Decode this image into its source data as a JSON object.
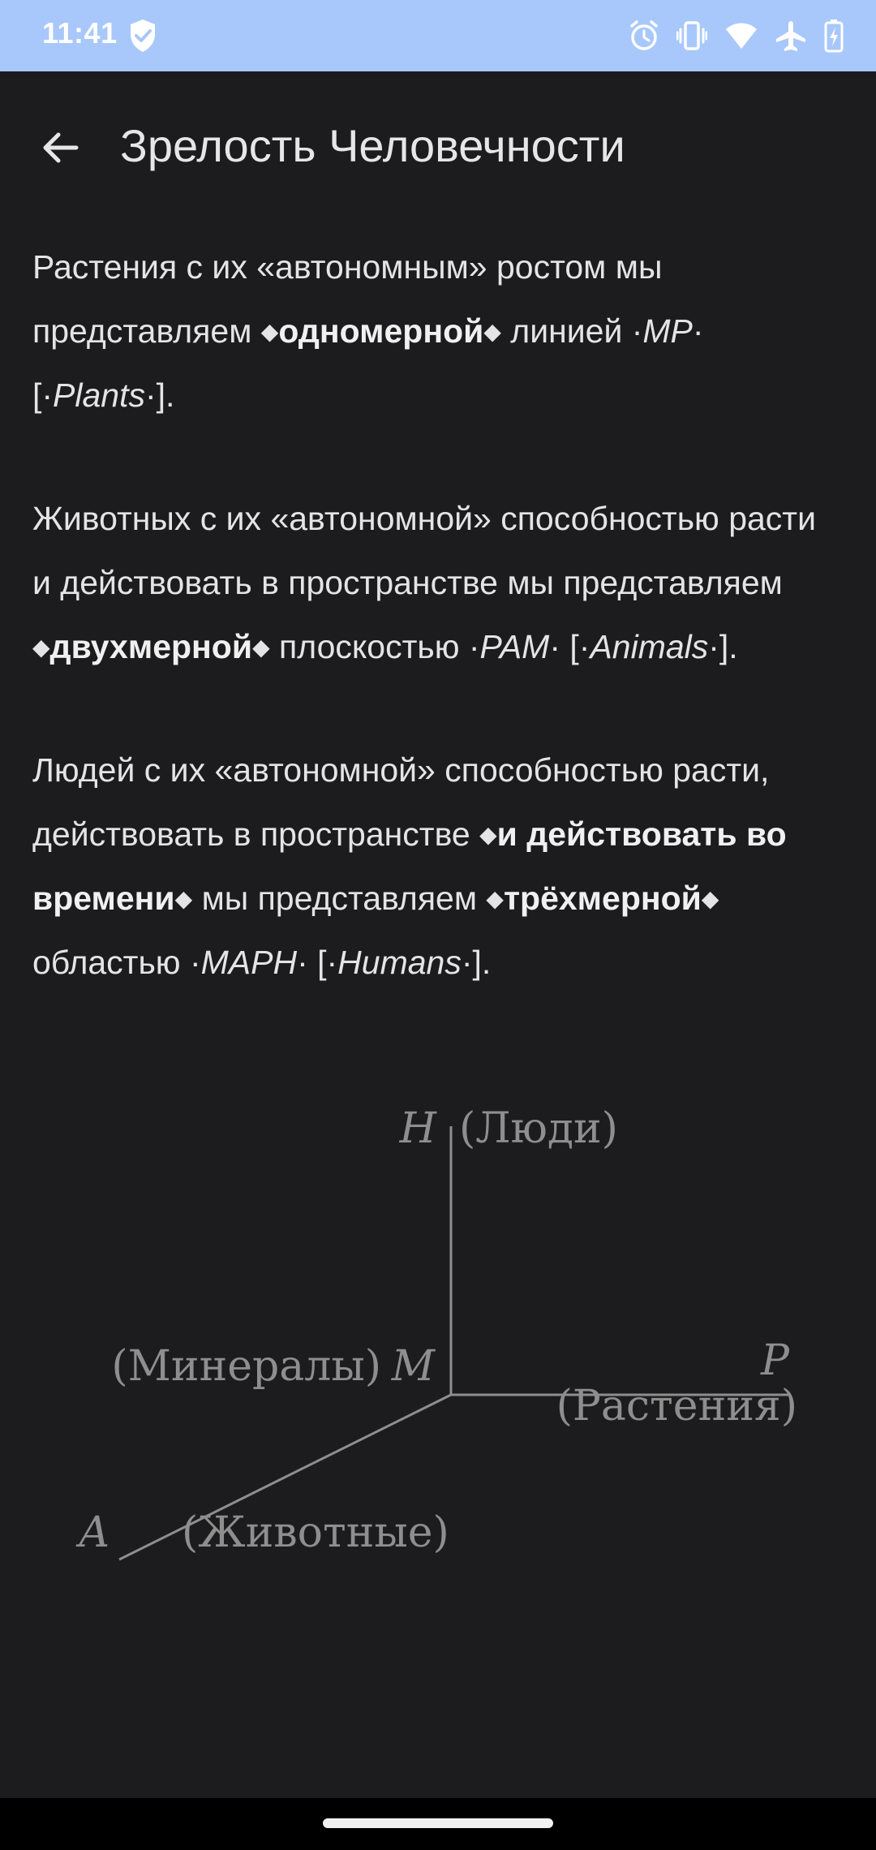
{
  "status_bar": {
    "time": "11:41",
    "icons": [
      "shield-check-icon",
      "alarm-icon",
      "vibrate-icon",
      "wifi-icon",
      "airplane-icon",
      "battery-charging-icon"
    ]
  },
  "header": {
    "title": "Зрелость Человечности",
    "back_icon": "arrow-back-icon"
  },
  "article": {
    "p1": {
      "t1": "Растения с их «автономным» ростом мы представляем ",
      "bold1": "одномерной",
      "t2": " линией ·",
      "it1": "MP",
      "t3": "· [·",
      "it2": "Plants",
      "t4": "·]."
    },
    "p2": {
      "t1": "Животных с их «автономной» способностью расти и действовать в пространстве мы представляем ",
      "bold1": "двухмерной",
      "t2": " плоскостью ·",
      "it1": "PAM",
      "t3": "· [·",
      "it2": "Animals",
      "t4": "·]."
    },
    "p3": {
      "t1": "Людей с их «автономной» способностью расти, действовать в пространстве ",
      "bold1": "и действовать во времени",
      "t2": " мы представляем ",
      "bold2": "трёхмерной",
      "t3": " областью ·",
      "it1": "MAPH",
      "t4": "· [·",
      "it2": "Humans",
      "t5": "·]."
    }
  },
  "diagram": {
    "axis_h": "H",
    "label_h": "(Люди)",
    "axis_m": "M",
    "label_m": "(Минералы)",
    "axis_p": "P",
    "label_p": "(Растения)",
    "axis_a": "A",
    "label_a": "(Животные)",
    "line_color": "#8e8e8e"
  },
  "colors": {
    "status_bar_bg": "#a8c8fb",
    "background": "#1c1c1e",
    "text": "#e4e4e4"
  }
}
